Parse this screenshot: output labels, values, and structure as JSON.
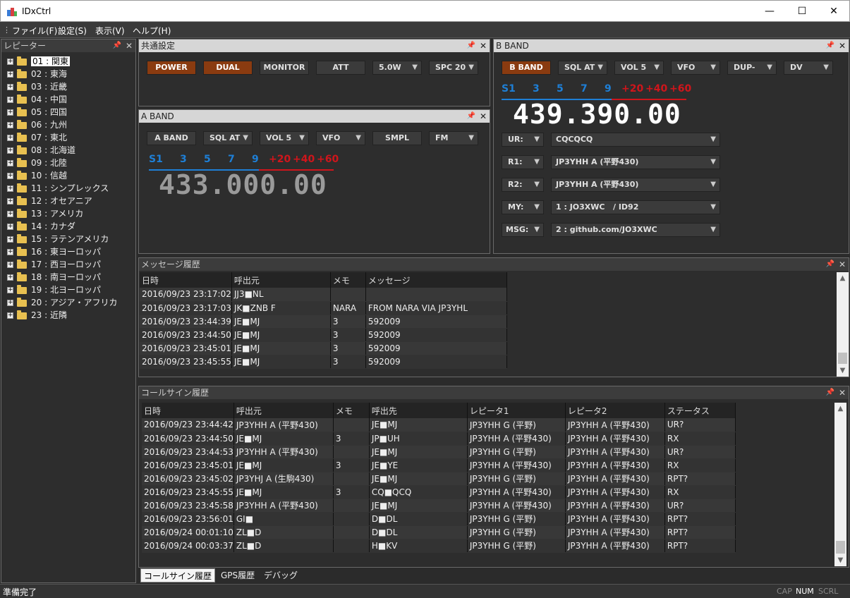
{
  "window": {
    "title": "IDxCtrl",
    "minimize": "—",
    "maximize": "☐",
    "close": "✕"
  },
  "menu": {
    "items": [
      "ファイル(F)",
      "設定(S)",
      "表示(V)",
      "ヘルプ(H)"
    ]
  },
  "repeater_panel": {
    "title": "レピーター",
    "items": [
      "01 : 関東",
      "02 : 東海",
      "03 : 近畿",
      "04 : 中国",
      "05 : 四国",
      "06 : 九州",
      "07 : 東北",
      "08 : 北海道",
      "09 : 北陸",
      "10 : 信越",
      "11 : シンプレックス",
      "12 : オセアニア",
      "13 : アメリカ",
      "14 : カナダ",
      "15 : ラテンアメリカ",
      "16 : 東ヨーロッパ",
      "17 : 西ヨーロッパ",
      "18 : 南ヨーロッパ",
      "19 : 北ヨーロッパ",
      "20 : アジア・アフリカ",
      "23 : 近隣"
    ],
    "selected_index": 0
  },
  "common_panel": {
    "title": "共通設定",
    "power": "POWER",
    "dual": "DUAL",
    "monitor": "MONITOR",
    "att": "ATT",
    "power_level": "5.0W",
    "spc": "SPC 20"
  },
  "a_band": {
    "title": "A BAND",
    "band": "A BAND",
    "sql": "SQL AT",
    "vol": "VOL 5",
    "mode": "VFO",
    "smpl": "SMPL",
    "modulation": "FM",
    "frequency": "433.000.00"
  },
  "b_band": {
    "title": "B BAND",
    "band": "B BAND",
    "sql": "SQL AT",
    "vol": "VOL 5",
    "mode": "VFO",
    "dup": "DUP-",
    "modulation": "DV",
    "frequency": "439.390.00",
    "ur_label": "UR:",
    "ur_value": "CQCQCQ",
    "r1_label": "R1:",
    "r1_value": "JP3YHH A (平野430)",
    "r2_label": "R2:",
    "r2_value": "JP3YHH A (平野430)",
    "my_label": "MY:",
    "my_value": "1 : JO3XWC   / ID92",
    "msg_label": "MSG:",
    "msg_value": "2 : github.com/JO3XWC"
  },
  "meter": {
    "s1": "S1",
    "s3": "3",
    "s5": "5",
    "s7": "7",
    "s9": "9",
    "p20": "+20",
    "p40": "+40",
    "p60": "+60"
  },
  "messages": {
    "title": "メッセージ履歴",
    "columns": [
      "日時",
      "呼出元",
      "メモ",
      "メッセージ"
    ],
    "rows": [
      [
        "2016/09/23 23:17:02",
        "JJ3■NL",
        "",
        ""
      ],
      [
        "2016/09/23 23:17:03",
        "JK■ZNB F",
        "NARA",
        "FROM NARA VIA JP3YHL"
      ],
      [
        "2016/09/23 23:44:39",
        "JE■MJ",
        "3",
        "592009"
      ],
      [
        "2016/09/23 23:44:50",
        "JE■MJ",
        "3",
        "592009"
      ],
      [
        "2016/09/23 23:45:01",
        "JE■MJ",
        "3",
        "592009"
      ],
      [
        "2016/09/23 23:45:55",
        "JE■MJ",
        "3",
        "592009"
      ]
    ]
  },
  "callsigns": {
    "title": "コールサイン履歴",
    "columns": [
      "日時",
      "呼出元",
      "メモ",
      "呼出先",
      "レピータ1",
      "レピータ2",
      "ステータス"
    ],
    "rows": [
      [
        "2016/09/23 23:44:42",
        "JP3YHH A (平野430)",
        "",
        "JE■MJ",
        "JP3YHH G (平野)",
        "JP3YHH A (平野430)",
        "UR?"
      ],
      [
        "2016/09/23 23:44:50",
        "JE■MJ",
        "3",
        "JP■UH",
        "JP3YHH A (平野430)",
        "JP3YHH A (平野430)",
        "RX"
      ],
      [
        "2016/09/23 23:44:53",
        "JP3YHH A (平野430)",
        "",
        "JE■MJ",
        "JP3YHH G (平野)",
        "JP3YHH A (平野430)",
        "UR?"
      ],
      [
        "2016/09/23 23:45:01",
        "JE■MJ",
        "3",
        "JE■YE",
        "JP3YHH A (平野430)",
        "JP3YHH A (平野430)",
        "RX"
      ],
      [
        "2016/09/23 23:45:02",
        "JP3YHJ A (生駒430)",
        "",
        "JE■MJ",
        "JP3YHH G (平野)",
        "JP3YHH A (平野430)",
        "RPT?"
      ],
      [
        "2016/09/23 23:45:55",
        "JE■MJ",
        "3",
        "CQ■QCQ",
        "JP3YHH A (平野430)",
        "JP3YHH A (平野430)",
        "RX"
      ],
      [
        "2016/09/23 23:45:58",
        "JP3YHH A (平野430)",
        "",
        "JE■MJ",
        "JP3YHH A (平野430)",
        "JP3YHH A (平野430)",
        "UR?"
      ],
      [
        "2016/09/23 23:56:01",
        "GI■",
        "",
        "D■DL",
        "JP3YHH G (平野)",
        "JP3YHH A (平野430)",
        "RPT?"
      ],
      [
        "2016/09/24 00:01:10",
        "ZL■D",
        "",
        "D■DL",
        "JP3YHH G (平野)",
        "JP3YHH A (平野430)",
        "RPT?"
      ],
      [
        "2016/09/24 00:03:37",
        "ZL■D",
        "",
        "H■KV",
        "JP3YHH G (平野)",
        "JP3YHH A (平野430)",
        "RPT?"
      ]
    ]
  },
  "tabs": [
    "コールサイン履歴",
    "GPS履歴",
    "デバッグ"
  ],
  "status": {
    "text": "準備完了",
    "cap": "CAP",
    "num": "NUM",
    "scrl": "SCRL"
  },
  "colors": {
    "active_button": "#8a3b10",
    "meter_blue": "#1e7fd6",
    "meter_red": "#d0151b"
  }
}
